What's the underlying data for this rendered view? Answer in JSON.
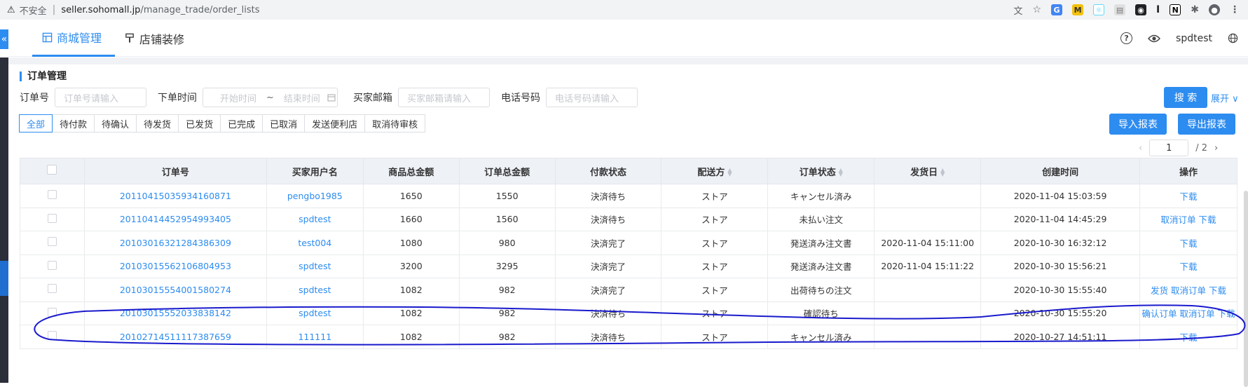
{
  "browser": {
    "insecure_label": "不安全",
    "url_host": "seller.sohomall.jp",
    "url_path": "/manage_trade/order_lists"
  },
  "header": {
    "tab_mall": "商城管理",
    "tab_decor": "店铺装修",
    "user": "spdtest"
  },
  "section": {
    "title": "订单管理"
  },
  "filters": {
    "order_no_label": "订单号",
    "order_no_placeholder": "订单号请输入",
    "order_time_label": "下单时间",
    "start_placeholder": "开始时间",
    "range_sep": "~",
    "end_placeholder": "结束时间",
    "email_label": "买家邮箱",
    "email_placeholder": "买家邮箱请输入",
    "phone_label": "电话号码",
    "phone_placeholder": "电话号码请输入",
    "search_btn": "搜 索",
    "expand": "展开"
  },
  "status_tabs": [
    "全部",
    "待付款",
    "待确认",
    "待发货",
    "已发货",
    "已完成",
    "已取消",
    "发送便利店",
    "取消待审核"
  ],
  "actions": {
    "import": "导入报表",
    "export": "导出报表"
  },
  "pager": {
    "current": "1",
    "total": "/ 2"
  },
  "table": {
    "headers": [
      "订单号",
      "买家用户名",
      "商品总金额",
      "订单总金额",
      "付款状态",
      "配送方",
      "订单状态",
      "发货日",
      "创建时间",
      "操作"
    ],
    "rows": [
      {
        "order": "20110415035934160871",
        "buyer": "pengbo1985",
        "goods": "1650",
        "total": "1550",
        "pay": "決済待ち",
        "ship": "ストア",
        "status": "キャンセル済み",
        "ship_date": "",
        "created": "2020-11-04 15:03:59",
        "ops": "下载"
      },
      {
        "order": "20110414452954993405",
        "buyer": "spdtest",
        "goods": "1660",
        "total": "1560",
        "pay": "決済待ち",
        "ship": "ストア",
        "status": "未払い注文",
        "ship_date": "",
        "created": "2020-11-04 14:45:29",
        "ops": "取消订单 下载"
      },
      {
        "order": "20103016321284386309",
        "buyer": "test004",
        "goods": "1080",
        "total": "980",
        "pay": "決済完了",
        "ship": "ストア",
        "status": "発送済み注文書",
        "ship_date": "2020-11-04 15:11:00",
        "created": "2020-10-30 16:32:12",
        "ops": "下载"
      },
      {
        "order": "20103015562106804953",
        "buyer": "spdtest",
        "goods": "3200",
        "total": "3295",
        "pay": "決済完了",
        "ship": "ストア",
        "status": "発送済み注文書",
        "ship_date": "2020-11-04 15:11:22",
        "created": "2020-10-30 15:56:21",
        "ops": "下载"
      },
      {
        "order": "20103015554001580274",
        "buyer": "spdtest",
        "goods": "1082",
        "total": "982",
        "pay": "決済完了",
        "ship": "ストア",
        "status": "出荷待ちの注文",
        "ship_date": "",
        "created": "2020-10-30 15:55:40",
        "ops": "发货 取消订单 下载"
      },
      {
        "order": "20103015552033838142",
        "buyer": "spdtest",
        "goods": "1082",
        "total": "982",
        "pay": "決済待ち",
        "ship": "ストア",
        "status": "確認待ち",
        "ship_date": "",
        "created": "2020-10-30 15:55:20",
        "ops": "确认订单 取消订单 下载"
      },
      {
        "order": "20102714511117387659",
        "buyer": "111111",
        "goods": "1082",
        "total": "982",
        "pay": "決済待ち",
        "ship": "ストア",
        "status": "キャンセル済み",
        "ship_date": "",
        "created": "2020-10-27 14:51:11",
        "ops": "下载"
      }
    ]
  },
  "colors": {
    "accent": "#2d8cf0",
    "annotation": "#1a1acd"
  },
  "icons": [
    "warning-icon",
    "store-icon",
    "brush-icon",
    "help-icon",
    "eye-icon",
    "globe-icon",
    "calendar-icon",
    "chevron-left-icon",
    "chevron-right-icon"
  ]
}
